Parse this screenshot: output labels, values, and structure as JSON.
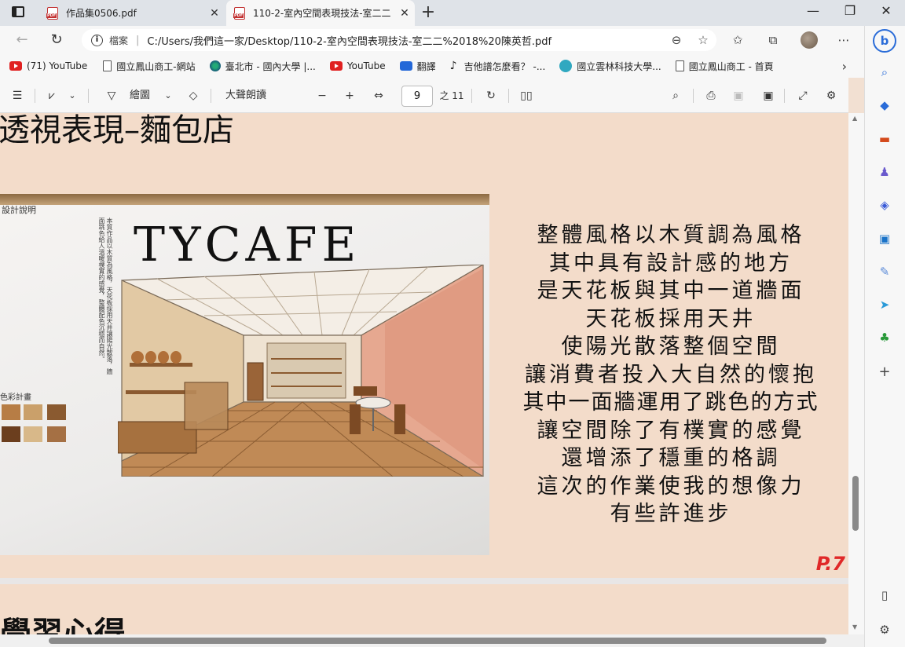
{
  "tabs": [
    {
      "title": "作品集0506.pdf",
      "close": "✕"
    },
    {
      "title": "110-2-室內空間表現技法-室二二",
      "close": "✕"
    }
  ],
  "new_tab": "+",
  "window_controls": {
    "minimize": "—",
    "maximize": "❐",
    "close": "✕"
  },
  "address": {
    "info_label": "檔案",
    "url": "C:/Users/我們這一家/Desktop/110-2-室內空間表現技法-室二二%2018%20陳英哲.pdf"
  },
  "bookmarks": [
    {
      "label": "(71) YouTube",
      "icon": "youtube-icon"
    },
    {
      "label": "國立鳳山商工-網站",
      "icon": "page-icon"
    },
    {
      "label": "臺北市 - 國內大學 |...",
      "icon": "globe-icon"
    },
    {
      "label": "YouTube",
      "icon": "youtube-icon"
    },
    {
      "label": "翻譯",
      "icon": "translate-icon"
    },
    {
      "label": "吉他譜怎麼看？ -...",
      "icon": "music-icon"
    },
    {
      "label": "國立雲林科技大學...",
      "icon": "yuntech-icon"
    },
    {
      "label": "國立鳳山商工 - 首頁",
      "icon": "page-icon"
    }
  ],
  "pdf_toolbar": {
    "draw_label": "繪圖",
    "read_aloud": "大聲朗讀",
    "current_page": "9",
    "total_pages": "之 11"
  },
  "document": {
    "heading": "透視表現–麵包店",
    "sketch": {
      "title": "TYCAFE",
      "description_heading": "設計說明",
      "description": "本質作品以木質為風格，天花板採用天井讓陽光散落，牆面跳色給人溫暖樸實的感覺，整體配色沉穩而自然。",
      "palette_heading": "色彩計畫",
      "palette_colors": [
        "#b77d45",
        "#caa06a",
        "#8a5a30",
        "#6b3e1e",
        "#d8b889",
        "#a57044"
      ]
    },
    "body_lines": [
      "整體風格以木質調為風格",
      "其中具有設計感的地方",
      "是天花板與其中一道牆面",
      "天花板採用天井",
      "使陽光散落整個空間",
      "讓消費者投入大自然的懷抱",
      "其中一面牆運用了跳色的方式",
      "讓空間除了有樸實的感覺",
      "還增添了穩重的格調",
      "這次的作業使我的想像力",
      "有些許進步"
    ],
    "page_number": "P.7",
    "next_heading": "學習心得"
  }
}
